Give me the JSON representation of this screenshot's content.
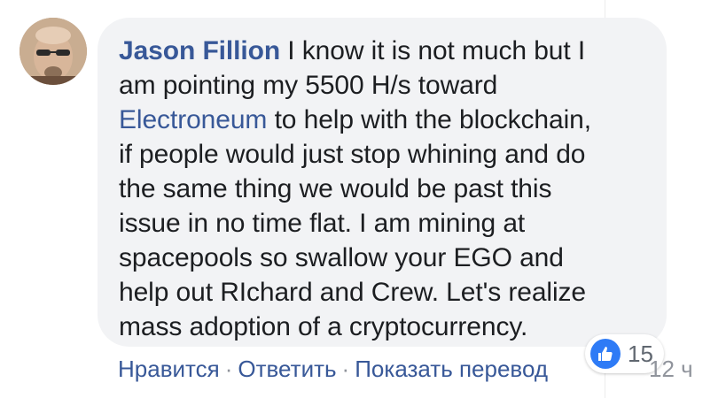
{
  "comment": {
    "author": "Jason Fillion",
    "lines": [
      " I know it is not much but I",
      "am pointing my 5500 H/s toward",
      " to help with the blockchain,",
      "if people would just stop whining and do",
      "the same thing we would be past this",
      "issue in no time flat. I am mining at",
      "spacepools so swallow your EGO and",
      "help out RIchard and Crew. Let's realize",
      "mass adoption of a cryptocurrency."
    ],
    "mention": "Electroneum"
  },
  "reactions": {
    "icon": "thumbs-up-icon",
    "count": "15",
    "color": "#2e7bf6"
  },
  "actions": {
    "like": "Нравится",
    "reply": "Ответить",
    "translate": "Показать перевод",
    "separator": "·",
    "time": "12 ч"
  },
  "colors": {
    "link": "#385898",
    "bubble": "#f2f3f5",
    "text": "#1c1e21",
    "muted": "#90949c"
  }
}
